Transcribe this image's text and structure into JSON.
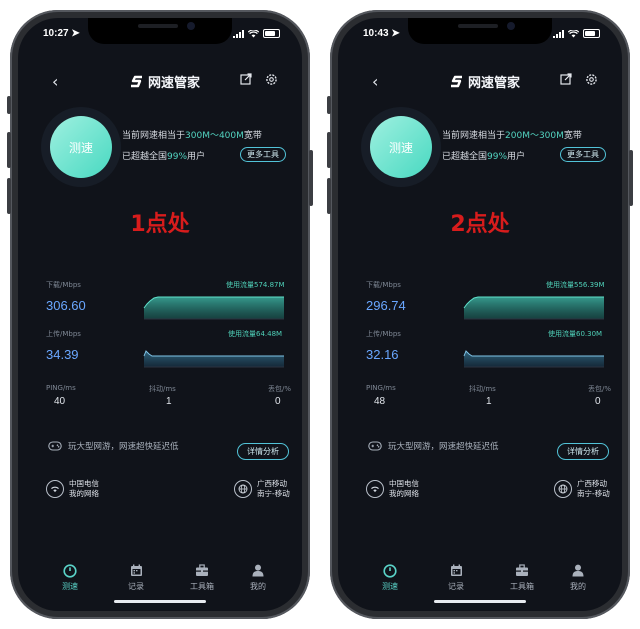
{
  "brand": {
    "name": "网速管家"
  },
  "colors": {
    "accent": "#52d3c0",
    "speed": "#6aa7ff",
    "annotation": "#d81c1c",
    "background": "#10131a"
  },
  "labels": {
    "circle_button": "测速",
    "equiv_prefix": "当前网速相当于",
    "equiv_suffix": "宽带",
    "beat_prefix": "已超越全国",
    "beat_suffix": "用户",
    "more_tools": "更多工具",
    "download": "下载/Mbps",
    "upload": "上传/Mbps",
    "used_prefix": "使用流量",
    "ping": "PING/ms",
    "jitter": "抖动/ms",
    "loss": "丢包/%",
    "game_text": "玩大型网游，网速超快延迟低",
    "detail_btn": "详情分析",
    "carrier_note": "我的网络"
  },
  "tabs": [
    {
      "label": "测速",
      "icon": "gauge-icon"
    },
    {
      "label": "记录",
      "icon": "calendar-icon"
    },
    {
      "label": "工具箱",
      "icon": "toolbox-icon"
    },
    {
      "label": "我的",
      "icon": "person-icon"
    }
  ],
  "phones": [
    {
      "time": "10:27",
      "annotation": "1点处",
      "bandwidth": "300M～400M",
      "beat_percent": "99%",
      "download": {
        "value": "306.60",
        "used": "574.87M"
      },
      "upload": {
        "value": "34.39",
        "used": "64.48M"
      },
      "ping": "40",
      "jitter": "1",
      "loss": "0",
      "carrier": "中国电信",
      "server_line1": "广西移动",
      "server_line2": "南宁-移动"
    },
    {
      "time": "10:43",
      "annotation": "2点处",
      "bandwidth": "200M～300M",
      "beat_percent": "99%",
      "download": {
        "value": "296.74",
        "used": "556.39M"
      },
      "upload": {
        "value": "32.16",
        "used": "60.30M"
      },
      "ping": "48",
      "jitter": "1",
      "loss": "0",
      "carrier": "中国电信",
      "server_line1": "广西移动",
      "server_line2": "南宁-移动"
    }
  ]
}
